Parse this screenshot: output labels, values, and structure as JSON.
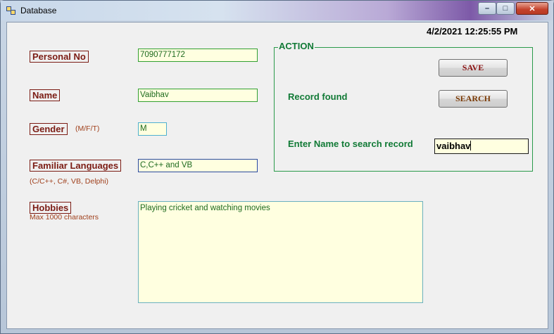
{
  "window": {
    "title": "Database",
    "minimize": "–",
    "maximize": "□",
    "close": "✕"
  },
  "datetime": "4/2/2021 12:25:55 PM",
  "form": {
    "personal_no": {
      "label": "Personal No",
      "value": "7090777172"
    },
    "name": {
      "label": "Name",
      "value": "Vaibhav"
    },
    "gender": {
      "label": "Gender",
      "hint": "(M/F/T)",
      "value": "M"
    },
    "languages": {
      "label": "Familiar Languages",
      "hint": "(C/C++, C#, VB, Delphi)",
      "value": "C,C++ and VB"
    },
    "hobbies": {
      "label": "Hobbies",
      "hint": "Max 1000 characters",
      "value": "Playing cricket and watching movies"
    }
  },
  "action": {
    "title": "ACTION",
    "save_label": "SAVE",
    "search_label": "SEARCH",
    "status": "Record found",
    "search_prompt": "Enter Name to search record",
    "search_value": "vaibhav"
  }
}
